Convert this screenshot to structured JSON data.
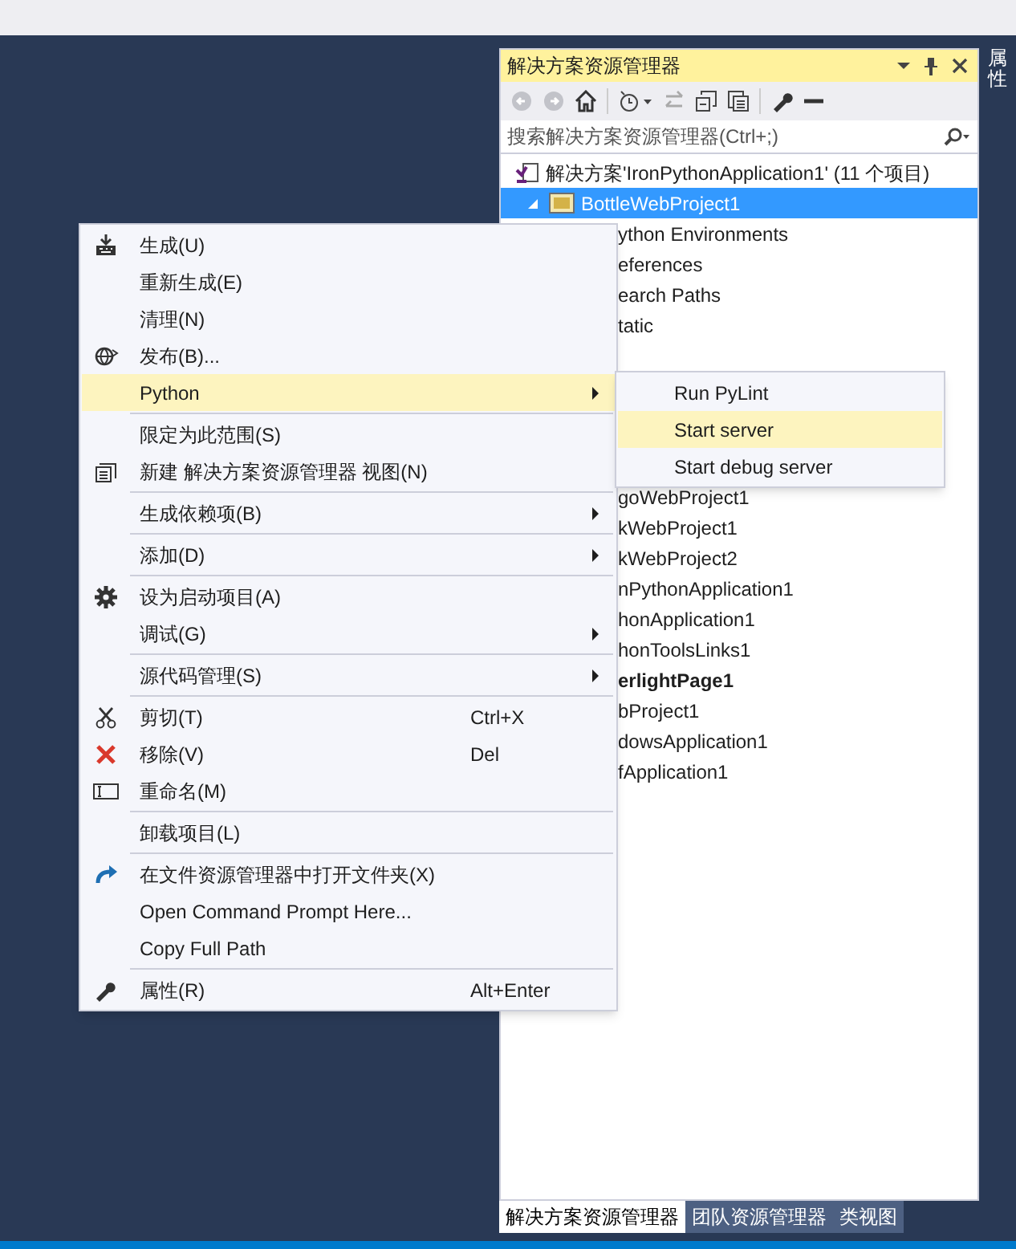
{
  "side_tab": {
    "label": "属性"
  },
  "solution_explorer": {
    "title": "解决方案资源管理器",
    "search": {
      "placeholder": "搜索解决方案资源管理器(Ctrl+;)"
    },
    "tree": [
      {
        "label": "解决方案'IronPythonApplication1' (11 个项目)",
        "selected": false,
        "children": [
          {
            "label": "BottleWebProject1",
            "selected": true,
            "expanded": true,
            "children": [
              {
                "label": "ython Environments",
                "selected": false,
                "covered": true
              },
              {
                "label": "eferences",
                "selected": false,
                "covered": true
              },
              {
                "label": "earch Paths",
                "selected": false,
                "covered": true
              },
              {
                "label": "tatic",
                "selected": false,
                "covered": true
              }
            ]
          },
          {
            "label": "goWebProject1",
            "selected": false,
            "covered": true
          },
          {
            "label": "kWebProject1",
            "selected": false,
            "covered": true
          },
          {
            "label": "kWebProject2",
            "selected": false,
            "covered": true
          },
          {
            "label": "nPythonApplication1",
            "selected": false,
            "covered": true
          },
          {
            "label": "honApplication1",
            "selected": false,
            "covered": true
          },
          {
            "label": "honToolsLinks1",
            "selected": false,
            "covered": true
          },
          {
            "label": "erlightPage1",
            "selected": false,
            "covered": true,
            "startup": true
          },
          {
            "label": "bProject1",
            "selected": false,
            "covered": true
          },
          {
            "label": "dowsApplication1",
            "selected": false,
            "covered": true
          },
          {
            "label": "fApplication1",
            "selected": false,
            "covered": true
          }
        ]
      }
    ]
  },
  "bottom_tabs": [
    {
      "label": "解决方案资源管理器",
      "selected": true
    },
    {
      "label": "团队资源管理器",
      "selected": false
    },
    {
      "label": "类视图",
      "selected": false
    }
  ],
  "context_menu": [
    {
      "kind": "command",
      "label": "生成(U)",
      "selected": false
    },
    {
      "kind": "command",
      "label": "重新生成(E)",
      "selected": false
    },
    {
      "kind": "command",
      "label": "清理(N)",
      "selected": false
    },
    {
      "kind": "command",
      "label": "发布(B)...",
      "selected": false
    },
    {
      "kind": "submenu",
      "label": "Python",
      "selected": true
    },
    {
      "kind": "separator"
    },
    {
      "kind": "command",
      "label": "限定为此范围(S)",
      "selected": false
    },
    {
      "kind": "command",
      "label": "新建 解决方案资源管理器 视图(N)",
      "selected": false
    },
    {
      "kind": "separator"
    },
    {
      "kind": "submenu",
      "label": "生成依赖项(B)",
      "selected": false
    },
    {
      "kind": "separator"
    },
    {
      "kind": "submenu",
      "label": "添加(D)",
      "selected": false
    },
    {
      "kind": "separator"
    },
    {
      "kind": "command",
      "label": "设为启动项目(A)",
      "selected": false
    },
    {
      "kind": "submenu",
      "label": "调试(G)",
      "selected": false
    },
    {
      "kind": "separator"
    },
    {
      "kind": "submenu",
      "label": "源代码管理(S)",
      "selected": false
    },
    {
      "kind": "separator"
    },
    {
      "kind": "command",
      "label": "剪切(T)",
      "shortcut": "Ctrl+X",
      "selected": false
    },
    {
      "kind": "command",
      "label": "移除(V)",
      "shortcut": "Del",
      "selected": false
    },
    {
      "kind": "command",
      "label": "重命名(M)",
      "selected": false
    },
    {
      "kind": "separator"
    },
    {
      "kind": "command",
      "label": "卸载项目(L)",
      "selected": false
    },
    {
      "kind": "separator"
    },
    {
      "kind": "command",
      "label": "在文件资源管理器中打开文件夹(X)",
      "selected": false
    },
    {
      "kind": "command",
      "label": "Open Command Prompt Here...",
      "selected": false
    },
    {
      "kind": "command",
      "label": "Copy Full Path",
      "selected": false
    },
    {
      "kind": "separator"
    },
    {
      "kind": "command",
      "label": "属性(R)",
      "shortcut": "Alt+Enter",
      "selected": false
    }
  ],
  "python_submenu": [
    {
      "label": "Run PyLint",
      "selected": false
    },
    {
      "label": "Start server",
      "selected": true
    },
    {
      "label": "Start debug server",
      "selected": false
    }
  ]
}
